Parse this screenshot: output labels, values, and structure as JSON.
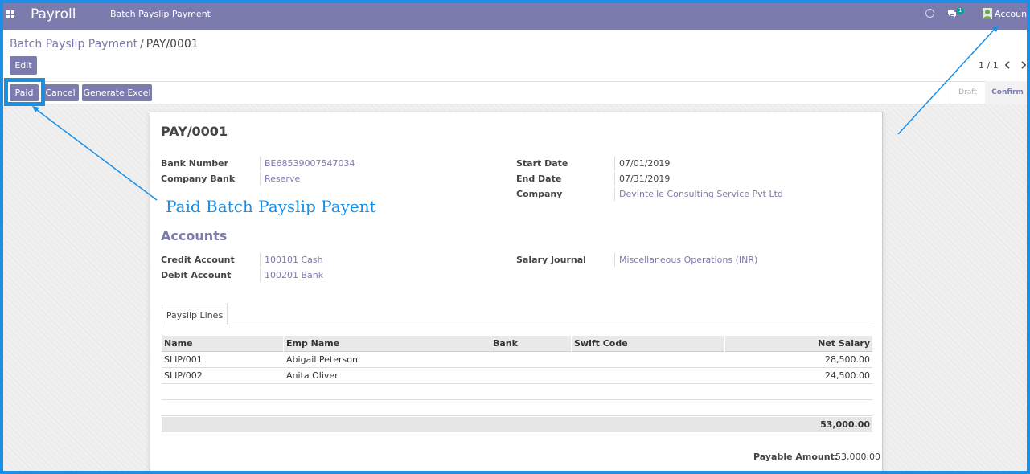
{
  "navbar": {
    "app_name": "Payroll",
    "menu_item": "Batch Payslip Payment",
    "chat_badge": "1",
    "account_label": "Account"
  },
  "breadcrumb": {
    "parent": "Batch Payslip Payment",
    "separator": "/",
    "current": "PAY/0001"
  },
  "control": {
    "edit_label": "Edit",
    "pager": "1 / 1"
  },
  "actions": {
    "paid_label": "Paid",
    "cancel_label": "Cancel",
    "excel_label": "Generate Excel"
  },
  "stages": {
    "draft": "Draft",
    "confirm": "Confirm",
    "active": "Confirm"
  },
  "record": {
    "title": "PAY/0001",
    "fields_left": [
      {
        "label": "Bank Number",
        "value": "BE68539007547034"
      },
      {
        "label": "Company Bank",
        "value": "Reserve"
      }
    ],
    "fields_right": [
      {
        "label": "Start Date",
        "value": "07/01/2019"
      },
      {
        "label": "End Date",
        "value": "07/31/2019"
      },
      {
        "label": "Company",
        "value": "DevIntelle Consulting Service Pvt Ltd"
      }
    ],
    "accounts_title": "Accounts",
    "accounts_left": [
      {
        "label": "Credit Account",
        "value": "100101 Cash"
      },
      {
        "label": "Debit Account",
        "value": "100201 Bank"
      }
    ],
    "accounts_right": [
      {
        "label": "Salary Journal",
        "value": "Miscellaneous Operations (INR)"
      }
    ]
  },
  "tabs": [
    {
      "label": "Payslip Lines"
    }
  ],
  "table": {
    "columns": [
      "Name",
      "Emp Name",
      "Bank",
      "Swift Code",
      "Net Salary"
    ],
    "rows": [
      {
        "name": "SLIP/001",
        "emp_name": "Abigail Peterson",
        "bank": "",
        "swift": "",
        "net_salary": "28,500.00"
      },
      {
        "name": "SLIP/002",
        "emp_name": "Anita Oliver",
        "bank": "",
        "swift": "",
        "net_salary": "24,500.00"
      }
    ],
    "total": "53,000.00"
  },
  "payable": {
    "label": "Payable Amount:",
    "value": "53,000.00"
  },
  "annotation": {
    "text": "Paid Batch Payslip Payent",
    "color": "#1a8fe6"
  },
  "colors": {
    "brand": "#7c7bad",
    "annotation": "#1a8fe6"
  }
}
